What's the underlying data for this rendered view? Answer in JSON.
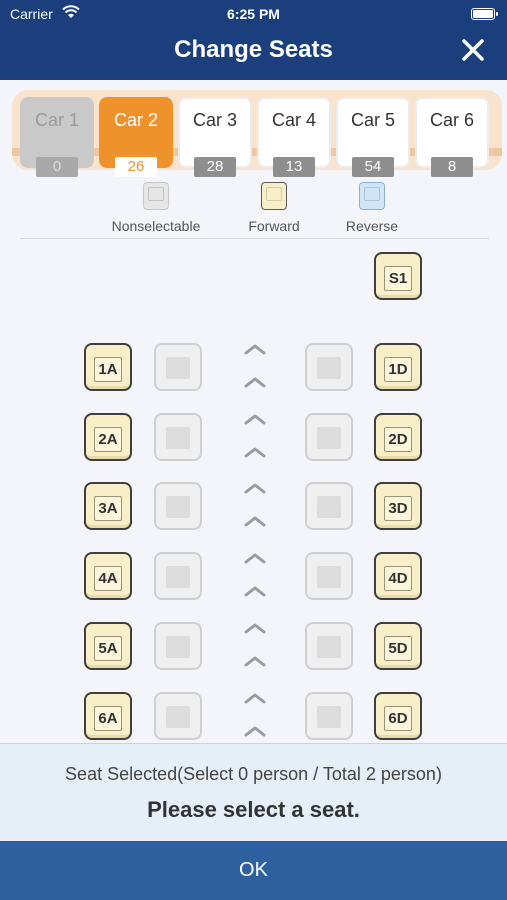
{
  "status": {
    "carrier": "Carrier",
    "time": "6:25 PM"
  },
  "header": {
    "title": "Change Seats"
  },
  "cars": [
    {
      "name": "Car 1",
      "count": "0",
      "state": "disabled"
    },
    {
      "name": "Car 2",
      "count": "26",
      "state": "selected"
    },
    {
      "name": "Car 3",
      "count": "28",
      "state": "normal"
    },
    {
      "name": "Car 4",
      "count": "13",
      "state": "normal"
    },
    {
      "name": "Car 5",
      "count": "54",
      "state": "normal"
    },
    {
      "name": "Car 6",
      "count": "8",
      "state": "normal"
    }
  ],
  "legend": [
    {
      "label": "Nonselectable",
      "type": "grey"
    },
    {
      "label": "Forward",
      "type": "forward"
    },
    {
      "label": "Reverse",
      "type": "reverse"
    }
  ],
  "seats": {
    "special": "S1",
    "rows": [
      {
        "a": "1A",
        "d": "1D"
      },
      {
        "a": "2A",
        "d": "2D"
      },
      {
        "a": "3A",
        "d": "3D"
      },
      {
        "a": "4A",
        "d": "4D"
      },
      {
        "a": "5A",
        "d": "5D"
      },
      {
        "a": "6A",
        "d": "6D"
      }
    ]
  },
  "selection": {
    "status_text": "Seat Selected(Select 0 person / Total 2 person)",
    "prompt": "Please select a seat."
  },
  "ok_label": "OK"
}
